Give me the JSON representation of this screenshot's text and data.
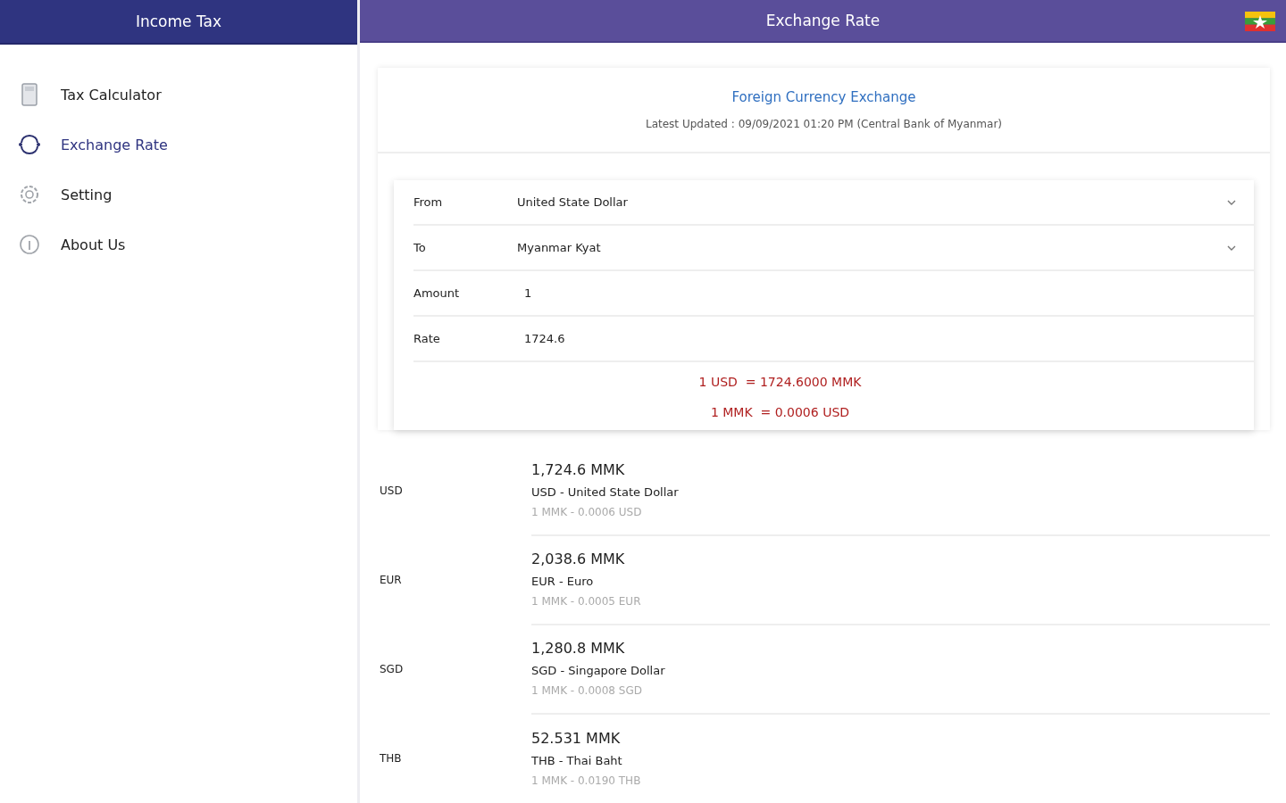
{
  "sidebar": {
    "title": "Income Tax",
    "items": [
      {
        "label": "Tax Calculator",
        "kind": "calculator",
        "selected": false
      },
      {
        "label": "Exchange Rate",
        "kind": "exchange",
        "selected": true
      },
      {
        "label": "Setting",
        "kind": "settings",
        "selected": false
      },
      {
        "label": "About Us",
        "kind": "info",
        "selected": false
      }
    ]
  },
  "header": {
    "title": "Exchange Rate"
  },
  "converter": {
    "title": "Foreign Currency Exchange",
    "updated": "Latest Updated : 09/09/2021 01:20 PM (Central Bank of Myanmar)",
    "fields": [
      {
        "kind": "select",
        "label": "From",
        "value": "United State Dollar"
      },
      {
        "kind": "select",
        "label": "To",
        "value": "Myanmar Kyat"
      },
      {
        "kind": "input",
        "label": "Amount",
        "value": "1"
      },
      {
        "kind": "input",
        "label": "Rate",
        "value": "1724.6"
      }
    ],
    "results": [
      "1 USD  = 1724.6000 MMK",
      "1 MMK  = 0.0006 USD"
    ]
  },
  "rates": [
    {
      "code": "USD",
      "amount": "1,724.6 MMK",
      "name": "USD - United State Dollar",
      "inverse": "1 MMK - 0.0006 USD"
    },
    {
      "code": "EUR",
      "amount": "2,038.6 MMK",
      "name": "EUR - Euro",
      "inverse": "1 MMK - 0.0005 EUR"
    },
    {
      "code": "SGD",
      "amount": "1,280.8 MMK",
      "name": "SGD - Singapore Dollar",
      "inverse": "1 MMK - 0.0008 SGD"
    },
    {
      "code": "THB",
      "amount": "52.531 MMK",
      "name": "THB - Thai Baht",
      "inverse": "1 MMK - 0.0190 THB"
    }
  ]
}
